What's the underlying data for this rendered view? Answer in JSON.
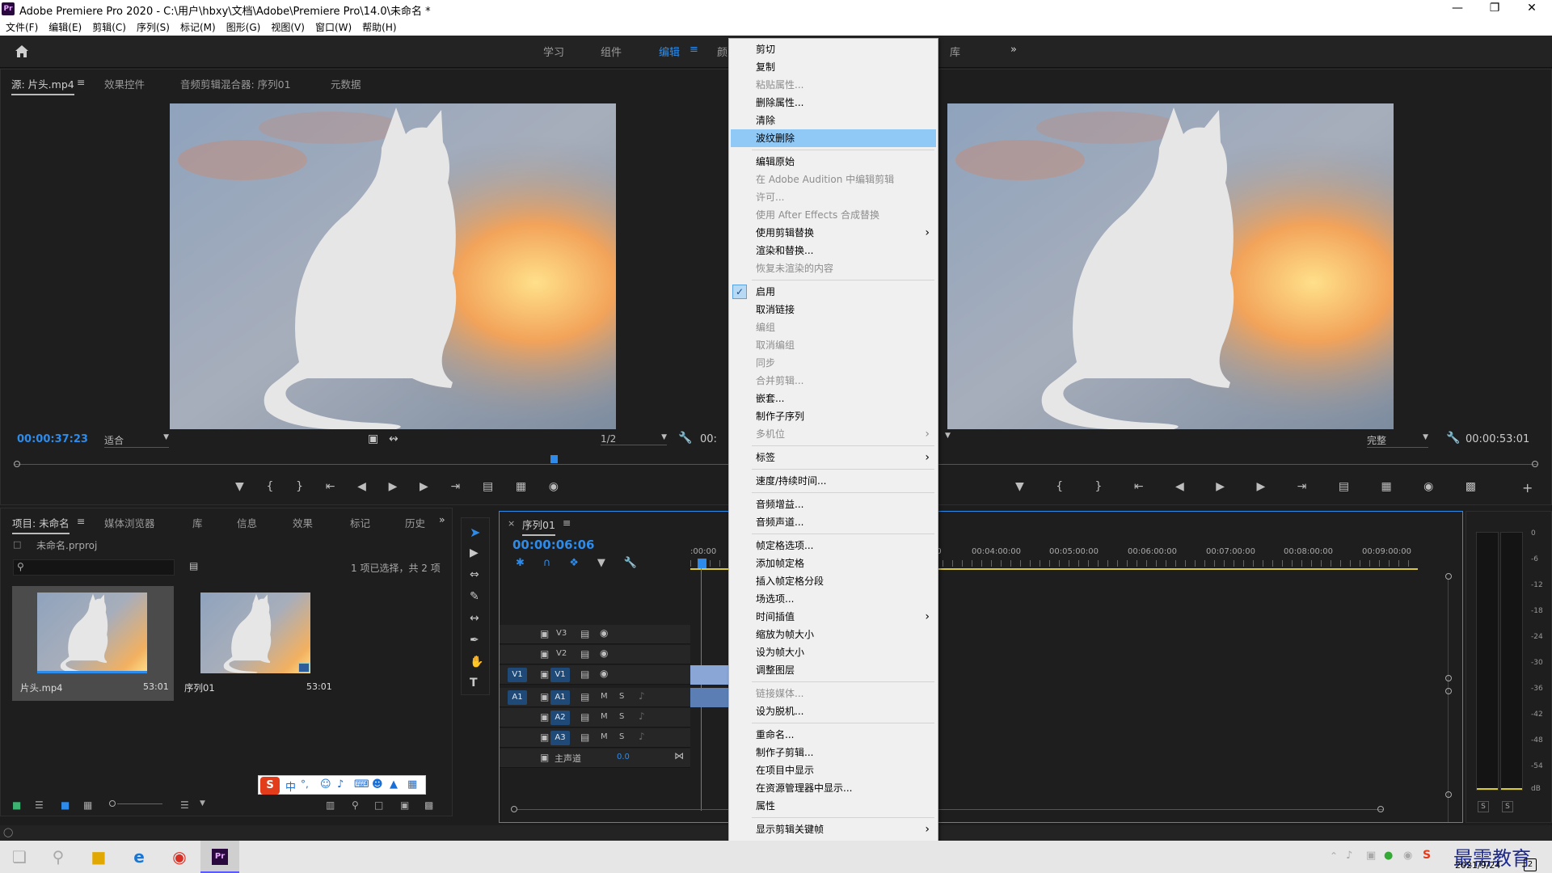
{
  "window": {
    "title": "Adobe Premiere Pro 2020 - C:\\用户\\hbxy\\文档\\Adobe\\Premiere Pro\\14.0\\未命名 *",
    "app_icon": "Pr"
  },
  "menubar": [
    "文件(F)",
    "编辑(E)",
    "剪辑(C)",
    "序列(S)",
    "标记(M)",
    "图形(G)",
    "视图(V)",
    "窗口(W)",
    "帮助(H)"
  ],
  "workspaces": [
    "学习",
    "组件",
    "编辑",
    "颜",
    "库"
  ],
  "source_panel": {
    "tabs": [
      "源: 片头.mp4",
      "效果控件",
      "音频剪辑混合器: 序列01",
      "元数据"
    ],
    "timecode": "00:00:37:23",
    "fit": "适合",
    "resolution": "1/2",
    "duration_partial": "00:"
  },
  "program_panel": {
    "fit": "完整",
    "timecode": "00:00:53:01"
  },
  "project_panel": {
    "tabs": [
      "项目: 未命名",
      "媒体浏览器",
      "库",
      "信息",
      "效果",
      "标记",
      "历史"
    ],
    "file": "未命名.prproj",
    "selection_info": "1 项已选择，共 2 项",
    "items": [
      {
        "name": "片头.mp4",
        "duration": "53:01"
      },
      {
        "name": "序列01",
        "duration": "53:01"
      }
    ]
  },
  "timeline": {
    "tab": "序列01",
    "timecode": "00:00:06:06",
    "ruler": [
      ":00:00",
      "00",
      "00:04:00:00",
      "00:05:00:00",
      "00:06:00:00",
      "00:07:00:00",
      "00:08:00:00",
      "00:09:00:00"
    ],
    "video_tracks": [
      "V3",
      "V2",
      "V1"
    ],
    "audio_tracks": [
      "A1",
      "A2",
      "A3"
    ],
    "source_v": "V1",
    "source_a": "A1",
    "master_label": "主声道",
    "master_value": "0.0",
    "m_label": "M",
    "s_label": "S"
  },
  "meter": {
    "scale": [
      "0",
      "-6",
      "-12",
      "-18",
      "-24",
      "-30",
      "-36",
      "-42",
      "-48",
      "-54",
      "dB"
    ],
    "buttons": [
      "S",
      "S"
    ]
  },
  "context_menu": {
    "items": [
      {
        "label": "剪切",
        "enabled": true
      },
      {
        "label": "复制",
        "enabled": true
      },
      {
        "label": "粘贴属性...",
        "enabled": false
      },
      {
        "label": "删除属性...",
        "enabled": true
      },
      {
        "label": "清除",
        "enabled": true
      },
      {
        "label": "波纹删除",
        "enabled": true,
        "highlighted": true
      },
      {
        "sep": true
      },
      {
        "label": "编辑原始",
        "enabled": true
      },
      {
        "label": "在 Adobe Audition 中编辑剪辑",
        "enabled": false
      },
      {
        "label": "许可...",
        "enabled": false
      },
      {
        "label": "使用 After Effects 合成替换",
        "enabled": false
      },
      {
        "label": "使用剪辑替换",
        "enabled": true,
        "submenu": true
      },
      {
        "label": "渲染和替换...",
        "enabled": true
      },
      {
        "label": "恢复未渲染的内容",
        "enabled": false
      },
      {
        "sep": true
      },
      {
        "label": "启用",
        "enabled": true,
        "checked": true
      },
      {
        "label": "取消链接",
        "enabled": true
      },
      {
        "label": "编组",
        "enabled": false
      },
      {
        "label": "取消编组",
        "enabled": false
      },
      {
        "label": "同步",
        "enabled": false
      },
      {
        "label": "合并剪辑...",
        "enabled": false
      },
      {
        "label": "嵌套...",
        "enabled": true
      },
      {
        "label": "制作子序列",
        "enabled": true
      },
      {
        "label": "多机位",
        "enabled": false,
        "submenu": true
      },
      {
        "sep": true
      },
      {
        "label": "标签",
        "enabled": true,
        "submenu": true
      },
      {
        "sep": true
      },
      {
        "label": "速度/持续时间...",
        "enabled": true
      },
      {
        "sep": true
      },
      {
        "label": "音频增益...",
        "enabled": true
      },
      {
        "label": "音频声道...",
        "enabled": true
      },
      {
        "sep": true
      },
      {
        "label": "帧定格选项...",
        "enabled": true
      },
      {
        "label": "添加帧定格",
        "enabled": true
      },
      {
        "label": "插入帧定格分段",
        "enabled": true
      },
      {
        "label": "场选项...",
        "enabled": true
      },
      {
        "label": "时间插值",
        "enabled": true,
        "submenu": true
      },
      {
        "label": "缩放为帧大小",
        "enabled": true
      },
      {
        "label": "设为帧大小",
        "enabled": true
      },
      {
        "label": "调整图层",
        "enabled": true
      },
      {
        "sep": true
      },
      {
        "label": "链接媒体...",
        "enabled": false
      },
      {
        "label": "设为脱机...",
        "enabled": true
      },
      {
        "sep": true
      },
      {
        "label": "重命名...",
        "enabled": true
      },
      {
        "label": "制作子剪辑...",
        "enabled": true
      },
      {
        "label": "在项目中显示",
        "enabled": true
      },
      {
        "label": "在资源管理器中显示...",
        "enabled": true
      },
      {
        "label": "属性",
        "enabled": true
      },
      {
        "sep": true
      },
      {
        "label": "显示剪辑关键帧",
        "enabled": true,
        "submenu": true
      }
    ]
  },
  "ime_toolbar": {
    "lang": "中",
    "punct": "°,"
  },
  "taskbar": {
    "date": "2021/9/24",
    "watermark": "最需教育",
    "notif": "2"
  }
}
